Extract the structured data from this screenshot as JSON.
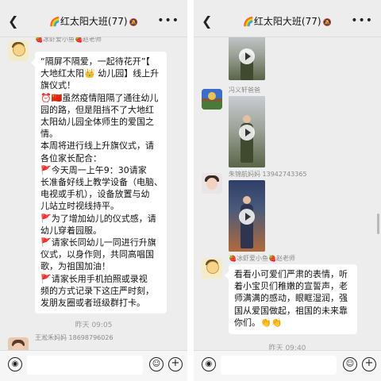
{
  "chat": {
    "back_glyph": "❮",
    "rainbow_glyph": "🌈",
    "title": "红太阳大班(77)",
    "mute_glyph": "🔕",
    "more_glyph": "•••"
  },
  "left": {
    "msg1": {
      "sender": "🍓冰虾爱小鱼🍓赵老师",
      "lines": [
        "“隔屏不隔爱，一起待花开”【",
        "大地红太阳👑 幼儿园】线上升",
        "旗仪式！",
        "⏰🇨🇳虽然疫情阻隔了通往幼儿",
        "园的路，但是阻挡不了大地红",
        "太阳幼儿园全体师生的爱国之",
        "情。",
        "本周将进行线上升旗仪式，请",
        "各位家长配合：",
        "🚩今天周一上午9：30请家",
        "长准备好线上教学设备（电脑、",
        "电视或手机），设备放置与幼",
        "儿站立时视线持平。",
        "🚩为了增加幼儿的仪式感，请",
        "幼儿穿着园服。",
        "🚩请家长同幼儿一同进行升旗",
        "仪式，以身作则，共同高唱国",
        "歌，为祖国加油！",
        "🚩请家长用手机拍照或录视",
        "频的方式记录下这庄严时刻，",
        "发朋友圈或者班级群打卡。"
      ]
    },
    "timestamp": "昨天 09:05",
    "msg2": {
      "sender": "王淞禾妈妈 18698796026"
    }
  },
  "right": {
    "video1": {
      "duration": ""
    },
    "msg_feng": {
      "sender": "冯义轩爸爸"
    },
    "msg_zhu": {
      "sender": "朱锦航妈妈 13942743365"
    },
    "msg_teacher": {
      "sender": "🍓冰虾爱小鱼🍓赵老师",
      "lines": [
        "看看小可爱们严肃的表情，听",
        "着小宝贝们稚嫩的宣誓声，老",
        "师满满的感动，眼眶湿润，强",
        "国从爱国做起，祖国的未来靠",
        "你们。👏👏"
      ]
    },
    "timestamp": "昨天 09:40"
  },
  "inputbar": {
    "voice_glyph": "◉",
    "emoji_glyph": "☺",
    "plus_glyph": "+"
  },
  "colors": {
    "background": "#ededed",
    "bubble": "#ffffff",
    "meta_text": "#8a8a8a"
  }
}
